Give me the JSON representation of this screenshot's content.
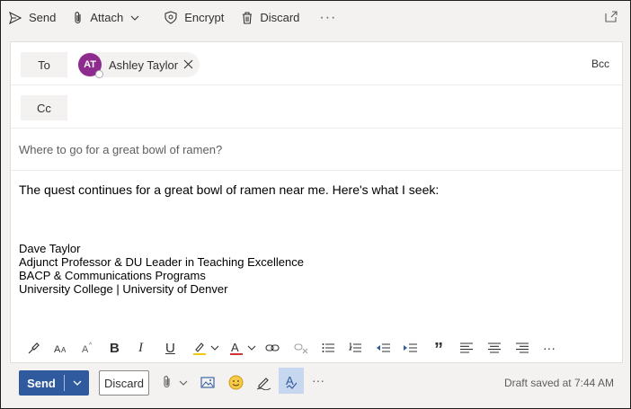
{
  "toolbar": {
    "send_label": "Send",
    "attach_label": "Attach",
    "encrypt_label": "Encrypt",
    "discard_label": "Discard",
    "more_label": "···"
  },
  "recipients": {
    "to_label": "To",
    "cc_label": "Cc",
    "bcc_label": "Bcc",
    "to": [
      {
        "initials": "AT",
        "name": "Ashley Taylor",
        "avatar_color": "#8e2b8e"
      }
    ]
  },
  "subject": "Where to go for a great bowl of ramen?",
  "body": {
    "text": "The quest continues for a great bowl of ramen near me. Here's what I seek:",
    "signature": [
      "Dave Taylor",
      "Adjunct Professor & DU Leader in Teaching Excellence",
      "BACP & Communications Programs",
      "University College | University of Denver"
    ]
  },
  "formatting": {
    "icons": [
      "format-painter-icon",
      "font-size-icon",
      "grow-font-icon",
      "bold-icon",
      "italic-icon",
      "underline-icon",
      "highlight-icon",
      "font-color-icon",
      "link-icon",
      "remove-link-icon",
      "bullets-icon",
      "numbering-icon",
      "decrease-indent-icon",
      "increase-indent-icon",
      "quote-icon",
      "align-left-icon",
      "align-center-icon",
      "align-right-icon",
      "more-icon"
    ],
    "bold_label": "B",
    "italic_label": "I",
    "underline_label": "U",
    "quote_label": "”",
    "more_label": "···"
  },
  "bottom": {
    "send_label": "Send",
    "discard_label": "Discard",
    "more_label": "···",
    "draft_status": "Draft saved at 7:44 AM"
  },
  "colors": {
    "send_blue": "#2f5a9e",
    "avatar": "#8e2b8e",
    "highlight": "#f2c811",
    "font_color": "#d13438"
  }
}
